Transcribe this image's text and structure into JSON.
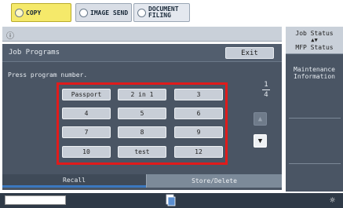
{
  "mode_tabs": {
    "copy": "COPY",
    "image_send": "IMAGE SEND",
    "document_filing_line1": "DOCUMENT",
    "document_filing_line2": "FILING"
  },
  "panel": {
    "title": "Job Programs",
    "exit_label": "Exit",
    "prompt": "Press program number."
  },
  "programs": [
    "Passport",
    "2 in 1",
    "3",
    "4",
    "5",
    "6",
    "7",
    "8",
    "9",
    "10",
    "test",
    "12"
  ],
  "pager": {
    "current": "1",
    "total": "4"
  },
  "tabs": {
    "recall": "Recall",
    "store_delete": "Store/Delete"
  },
  "right_panel": {
    "job_status": "Job Status",
    "mfp_status": "MFP Status",
    "maintenance_line1": "Maintenance",
    "maintenance_line2": "Information"
  },
  "colors": {
    "highlight": "#e01b1b",
    "active_tab": "#3b78c0",
    "copy_tab": "#f5e96a"
  }
}
